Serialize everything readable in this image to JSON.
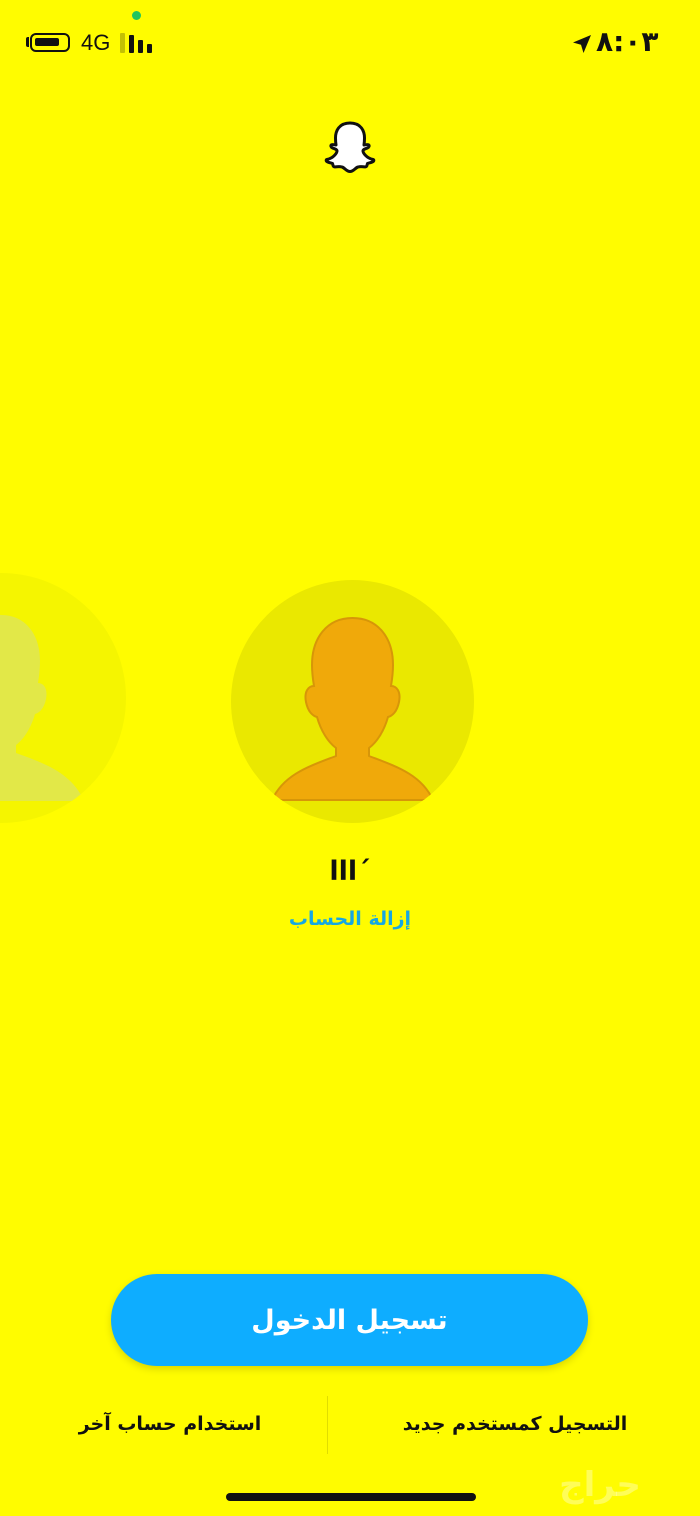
{
  "status_bar": {
    "network": "4G",
    "time": "٨:٠٣",
    "icons": [
      "battery-icon",
      "signal-icon",
      "location-arrow-icon"
    ]
  },
  "profile": {
    "username": "lll´",
    "remove_account": "إزالة الحساب"
  },
  "actions": {
    "login": "تسجيل الدخول",
    "use_another_account": "استخدام حساب آخر",
    "signup_new": "التسجيل كمستخدم جديد"
  },
  "watermark": "حراج",
  "colors": {
    "background": "#FFFC00",
    "primary_button": "#0EADFF",
    "link": "#16A7E3",
    "avatar": "#F0A90A"
  }
}
